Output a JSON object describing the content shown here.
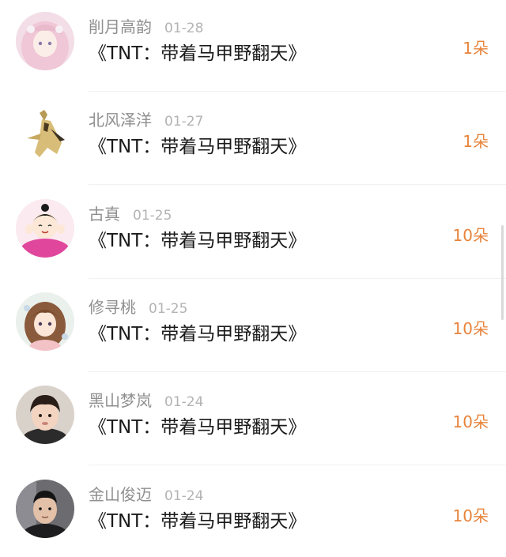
{
  "items": [
    {
      "name": "削月高韵",
      "date": "01-28",
      "title": "《TNT：带着马甲野翻天》",
      "count": "1朵",
      "avatar": "anime-girl-pink-hair-avatar"
    },
    {
      "name": "北风泽洋",
      "date": "01-27",
      "title": "《TNT：带着马甲野翻天》",
      "count": "1朵",
      "avatar": "golden-figure-avatar"
    },
    {
      "name": "古真",
      "date": "01-25",
      "title": "《TNT：带着马甲野翻天》",
      "count": "10朵",
      "avatar": "cartoon-girl-pink-avatar"
    },
    {
      "name": "修寻桃",
      "date": "01-25",
      "title": "《TNT：带着马甲野翻天》",
      "count": "10朵",
      "avatar": "anime-girl-brown-hair-avatar"
    },
    {
      "name": "黑山梦岚",
      "date": "01-24",
      "title": "《TNT：带着马甲野翻天》",
      "count": "10朵",
      "avatar": "child-photo-avatar"
    },
    {
      "name": "金山俊迈",
      "date": "01-24",
      "title": "《TNT：带着马甲野翻天》",
      "count": "10朵",
      "avatar": "man-photo-avatar"
    }
  ],
  "colors": {
    "accent": "#e8843c",
    "name": "#8f8f8f",
    "date": "#b3b3b3",
    "title": "#1a1a1a"
  }
}
